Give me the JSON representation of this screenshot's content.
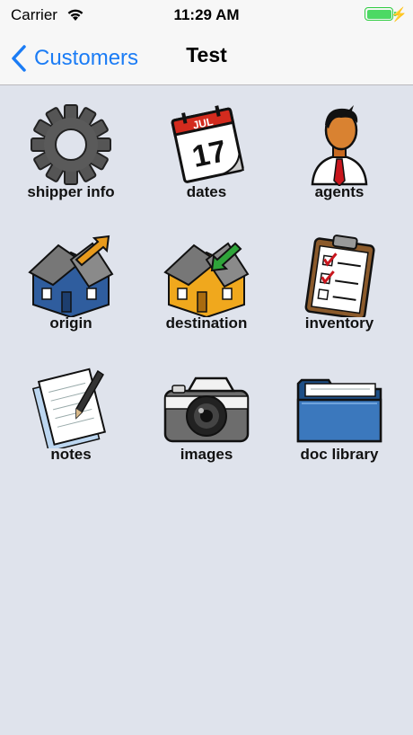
{
  "status_bar": {
    "carrier": "Carrier",
    "time": "11:29 AM",
    "wifi_icon": "wifi-icon",
    "battery_icon": "battery-icon",
    "battery_level": 1.0
  },
  "nav": {
    "back_label": "Customers",
    "title": "Test",
    "accent_color": "#1b7cf5"
  },
  "tiles": [
    {
      "label": "shipper info",
      "icon": "gear-icon"
    },
    {
      "label": "dates",
      "icon": "calendar-icon",
      "calendar_month": "JUL",
      "calendar_day": "17"
    },
    {
      "label": "agents",
      "icon": "person-icon"
    },
    {
      "label": "origin",
      "icon": "house-origin-icon"
    },
    {
      "label": "destination",
      "icon": "house-destination-icon"
    },
    {
      "label": "inventory",
      "icon": "clipboard-icon"
    },
    {
      "label": "notes",
      "icon": "notepad-icon"
    },
    {
      "label": "images",
      "icon": "camera-icon"
    },
    {
      "label": "doc library",
      "icon": "folder-icon"
    }
  ]
}
